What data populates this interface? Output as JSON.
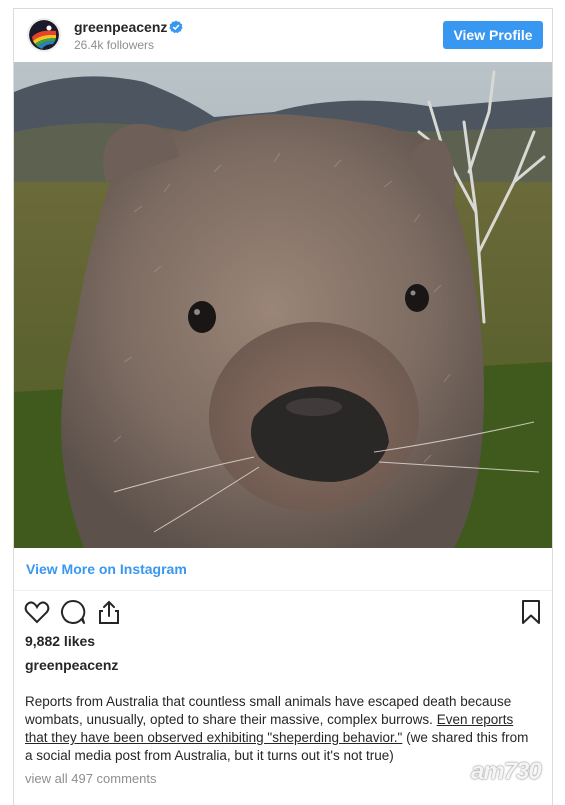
{
  "header": {
    "username": "greenpeacenz",
    "followers": "26.4k followers",
    "view_profile_label": "View Profile"
  },
  "post": {
    "view_more_label": "View More on Instagram",
    "likes": "9,882 likes",
    "caption_user": "greenpeacenz",
    "caption_text_1": "Reports from Australia that countless small animals have escaped death because wombats, unusually, opted to share their massive, complex burrows. ",
    "caption_text_highlighted": "Even reports that they have been observed exhibiting \"sheperding behavior.\"",
    "caption_text_2": " (we shared this from a social media post from Australia, but it turns out it's not true)",
    "comments_link": "view all 497 comments"
  },
  "icons": {
    "like": "heart-icon",
    "comment": "comment-icon",
    "share": "share-icon",
    "save": "bookmark-icon",
    "verified": "verified-badge-icon"
  },
  "colors": {
    "accent": "#3897f0",
    "text": "#262626",
    "muted": "#8e8e8e"
  },
  "watermark": "am730"
}
